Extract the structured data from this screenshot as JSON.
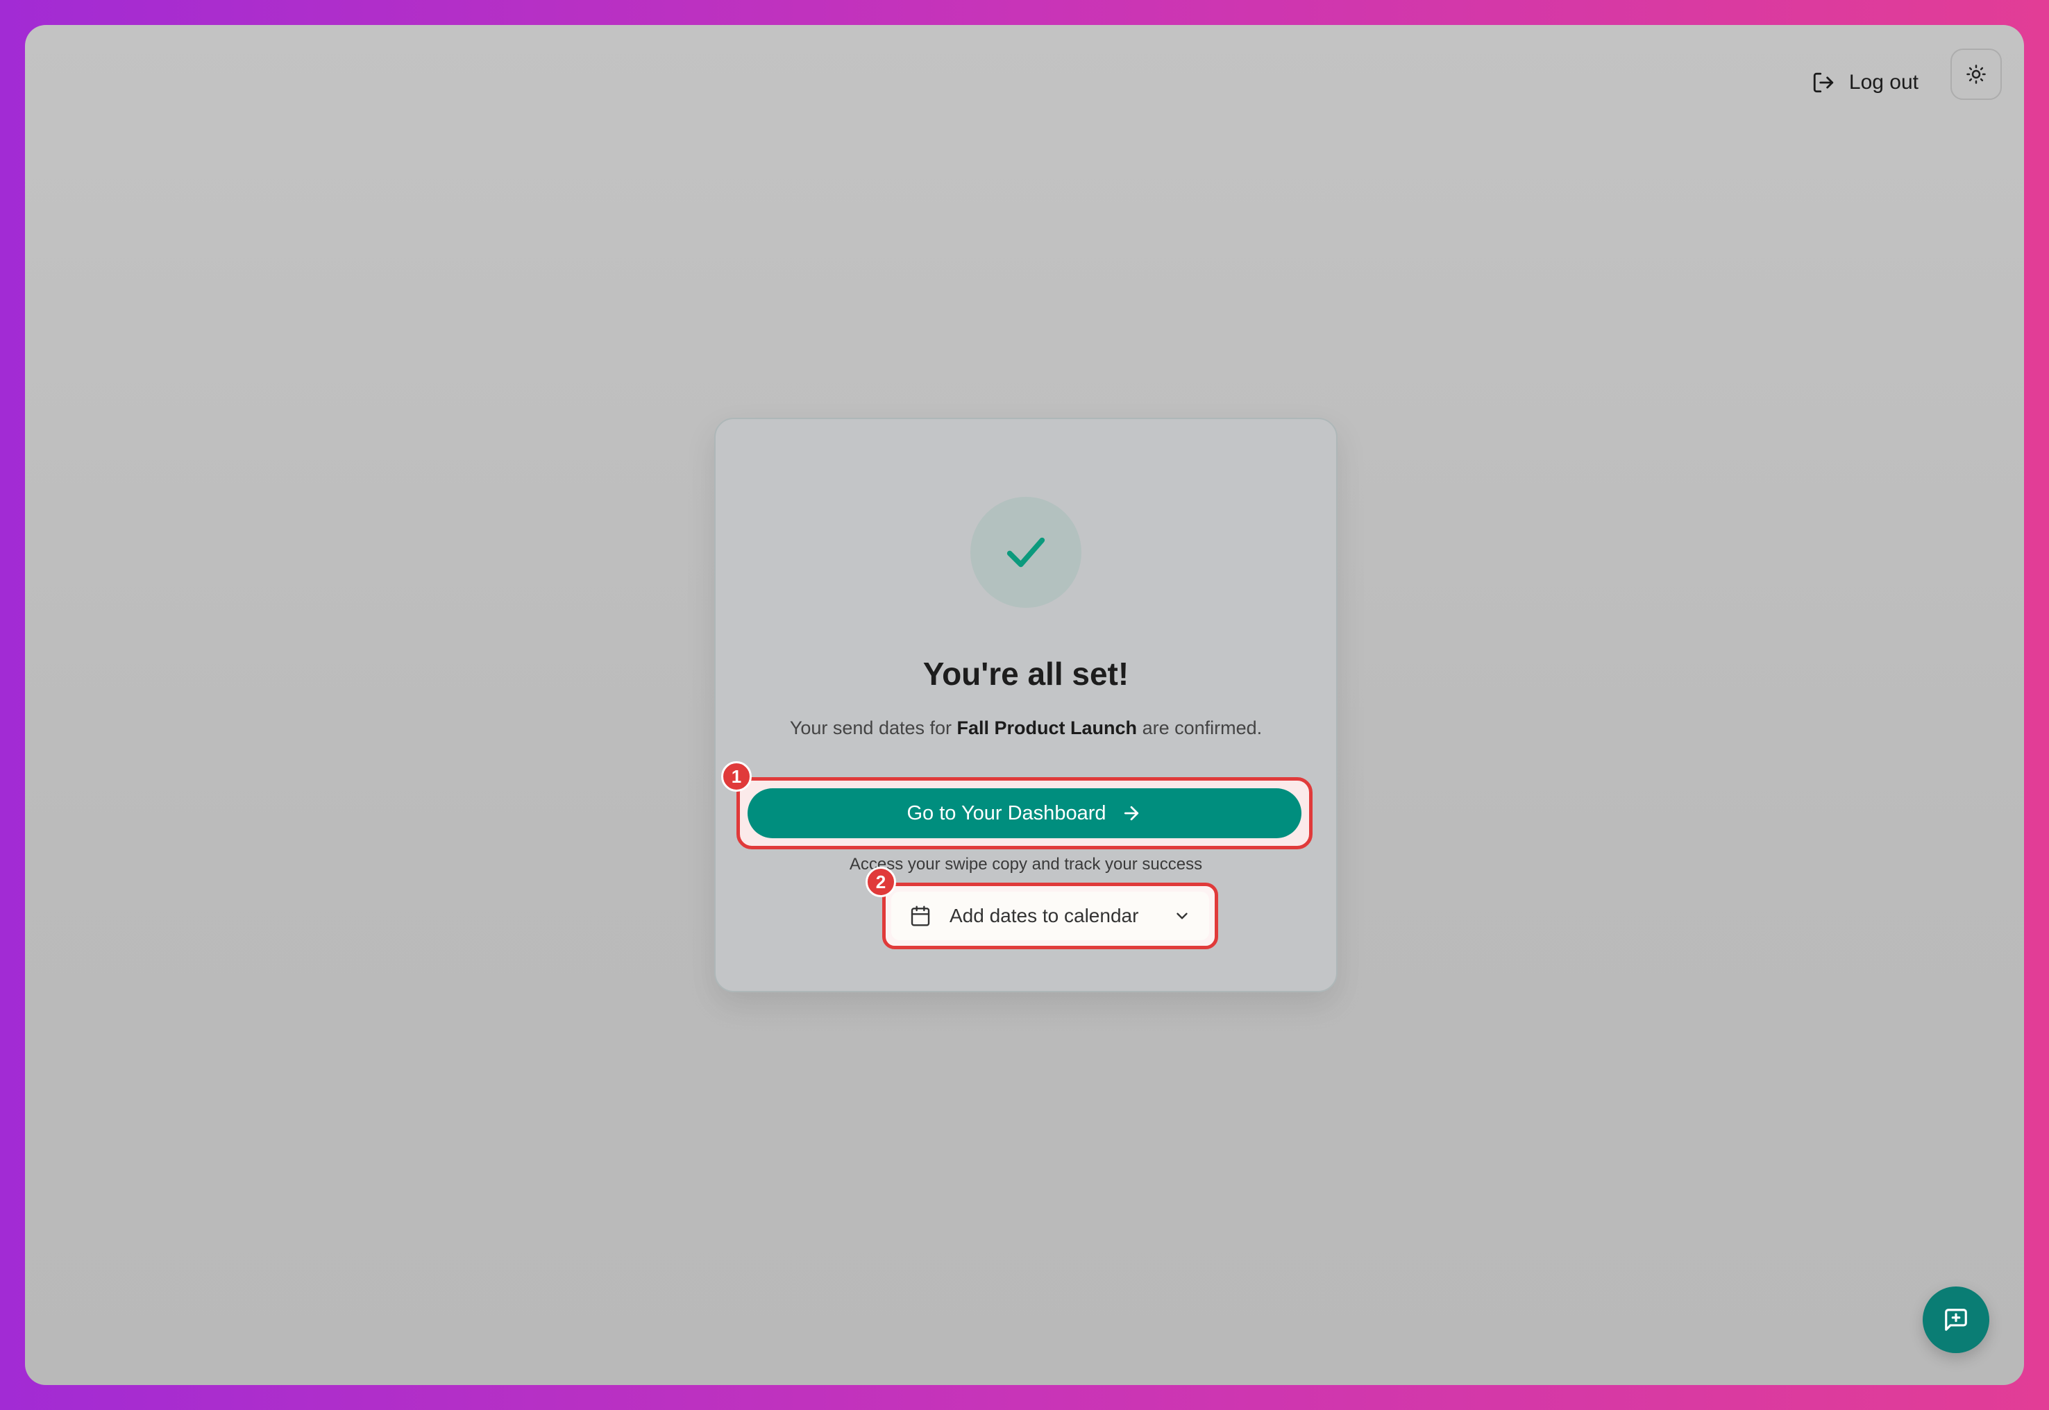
{
  "header": {
    "logout_label": "Log out",
    "logout_icon": "log-out-icon",
    "theme_icon": "sun-icon"
  },
  "card": {
    "title": "You're all set!",
    "subtitle_before": "Your send dates for",
    "campaign_name": "Fall Product Launch",
    "subtitle_after": "are confirmed.",
    "dashboard_button_label": "Go to Your Dashboard",
    "dashboard_subtext": "Access your swipe copy and track your success",
    "calendar_button_label": "Add dates to calendar",
    "calendar_icon": "calendar-icon",
    "chevron_icon": "chevron-down-icon"
  },
  "annotations": {
    "badge_1": "1",
    "badge_2": "2",
    "highlight_color": "#e03a3a"
  },
  "colors": {
    "accent": "#008e7e",
    "check": "#0c9a7d",
    "fab": "#0a7d74"
  },
  "chat": {
    "icon": "message-plus-icon"
  }
}
